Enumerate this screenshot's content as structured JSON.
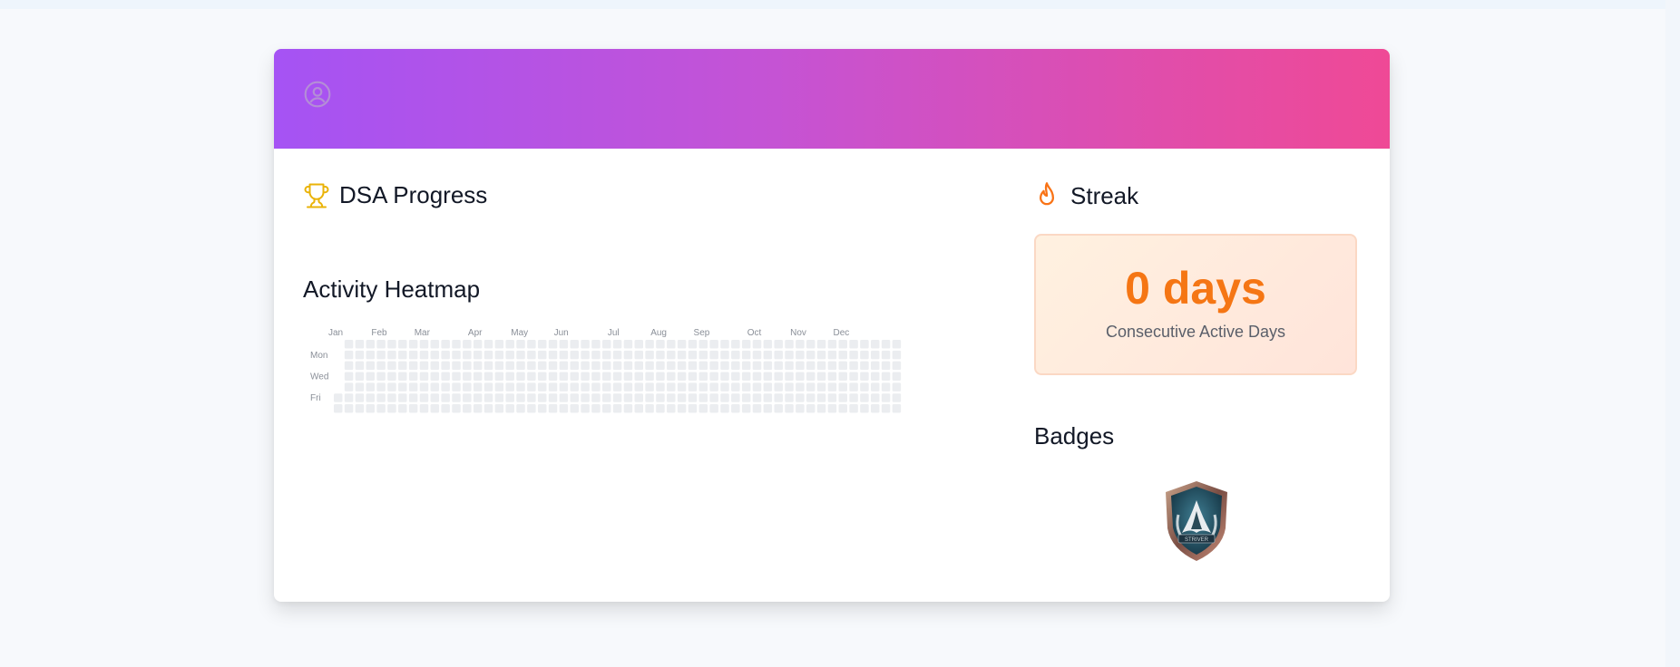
{
  "header": {
    "avatar_icon": "user-circle-icon"
  },
  "dsa": {
    "title": "DSA Progress",
    "icon": "trophy-icon"
  },
  "activity": {
    "title": "Activity Heatmap",
    "months": [
      "Jan",
      "Feb",
      "Mar",
      "Apr",
      "May",
      "Jun",
      "Jul",
      "Aug",
      "Sep",
      "Oct",
      "Nov",
      "Dec"
    ],
    "weekday_labels": [
      "Mon",
      "Wed",
      "Fri"
    ],
    "weeks": 53,
    "empty_color": "#ebedf0"
  },
  "streak": {
    "title": "Streak",
    "icon": "flame-icon",
    "value": "0 days",
    "caption": "Consecutive Active Days"
  },
  "badges": {
    "title": "Badges",
    "items": [
      {
        "name": "badge-shield",
        "text": "STRIVER"
      }
    ]
  },
  "colors": {
    "banner_start": "#a553f4",
    "banner_end": "#ef4996",
    "trophy": "#eab308",
    "flame": "#f97316",
    "streak_value": "#f57614"
  }
}
